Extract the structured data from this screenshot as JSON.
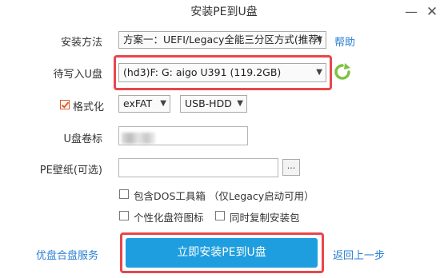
{
  "window": {
    "title": "安装PE到U盘",
    "minimize_glyph": "—",
    "close_glyph": "✕"
  },
  "form": {
    "scheme_label": "安装方法",
    "scheme_value": "方案一：UEFI/Legacy全能三分区方式(推荐)",
    "help_link": "帮助",
    "target_label": "待写入U盘",
    "target_value": "(hd3)F: G: aigo U391 (119.2GB)",
    "format_label": "格式化",
    "format_checked": true,
    "filesystem_value": "exFAT",
    "boot_mode_value": "USB-HDD",
    "volume_label": "U盘卷标",
    "wallpaper_label": "PE壁纸(可选)",
    "wallpaper_value": "",
    "browse_label": "...",
    "include_dos_label": "包含DOS工具箱 （仅Legacy启动可用）",
    "include_dos_checked": false,
    "custom_icon_label": "个性化盘符图标",
    "custom_icon_checked": false,
    "copy_installer_label": "同时复制安装包",
    "copy_installer_checked": false
  },
  "footer": {
    "left_link": "优盘合盘服务",
    "install_button": "立即安装PE到U盘",
    "back_link": "返回上一步"
  },
  "colors": {
    "accent": "#1e9ede",
    "highlight": "#e8474b",
    "refresh_icon": "#7fc241",
    "link": "#2a7fd0"
  }
}
